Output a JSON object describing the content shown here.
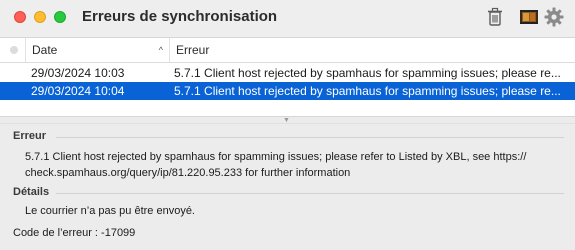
{
  "window": {
    "title": "Erreurs de synchronisation"
  },
  "toolbar": {
    "icons": [
      "trash-icon",
      "film-icon",
      "gear-icon"
    ]
  },
  "table": {
    "columns": {
      "date": "Date",
      "error": "Erreur"
    },
    "sort": "ascending",
    "rows": [
      {
        "date": "29/03/2024 10:03",
        "error": "5.7.1 Client host rejected by spamhaus for spamming issues; please re...",
        "selected": false
      },
      {
        "date": "29/03/2024 10:04",
        "error": "5.7.1 Client host rejected by spamhaus for spamming issues; please re...",
        "selected": true
      }
    ]
  },
  "details_panel": {
    "error_heading": "Erreur",
    "error_line1": "5.7.1 Client host rejected by spamhaus for spamming issues; please refer to Listed by XBL, see https://",
    "error_line2": "check.spamhaus.org/query/ip/81.220.95.233 for further information",
    "details_heading": "Détails",
    "details_text": "Le courrier n’a pas pu être envoyé.",
    "error_code": "Code de l’erreur : -17099"
  },
  "colors": {
    "selection": "#0a63d6",
    "close": "#ff5f57",
    "minimize": "#febc2e",
    "maximize": "#28c840"
  }
}
